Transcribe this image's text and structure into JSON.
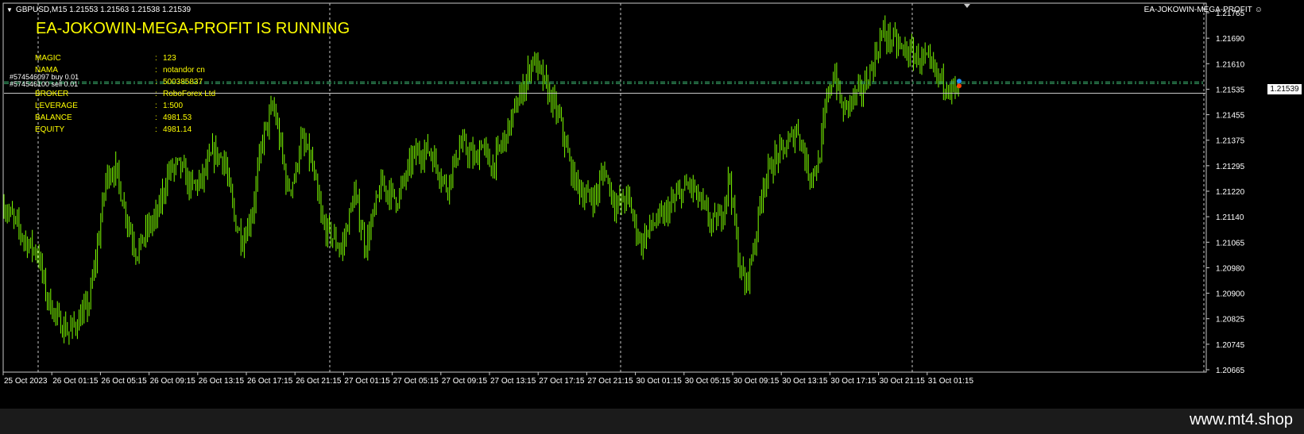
{
  "header": {
    "symbol_line": "GBPUSD,M15  1.21553 1.21563 1.21538 1.21539",
    "ea_name": "EA-JOKOWIN-MEGA-PROFIT",
    "smiley": "☺"
  },
  "ea_panel": {
    "title": "EA-JOKOWIN-MEGA-PROFIT IS RUNNING",
    "rows": [
      {
        "key": "MAGIC",
        "value": "123"
      },
      {
        "key": "NAMA",
        "value": "notandor cn"
      },
      {
        "key": "",
        "value": "500385837"
      },
      {
        "key": "BROKER",
        "value": "RoboForex Ltd"
      },
      {
        "key": "LEVERAGE",
        "value": "1:500"
      },
      {
        "key": "BALANCE",
        "value": "4981.53"
      },
      {
        "key": "EQUITY",
        "value": "4981.14"
      }
    ],
    "separator": ":"
  },
  "orders": [
    {
      "label": "#574546097 buy 0.01",
      "price": 1.21575
    },
    {
      "label": "#574546100 sell 0.01",
      "price": 1.21575
    }
  ],
  "watermark": "www.mt4.shop",
  "colors": {
    "background": "#000000",
    "candle": "#7CFC00",
    "text_yellow": "#ffff00",
    "grid": "#c8c8c8",
    "order_line": "#3cb371"
  },
  "chart_data": {
    "type": "candlestick",
    "symbol": "GBPUSD",
    "timeframe": "M15",
    "current_price": "1.21539",
    "ylim": [
      1.2066,
      1.218
    ],
    "y_ticks": [
      "1.21765",
      "1.21690",
      "1.21610",
      "1.21535",
      "1.21455",
      "1.21375",
      "1.21295",
      "1.21220",
      "1.21140",
      "1.21065",
      "1.20980",
      "1.20900",
      "1.20825",
      "1.20745",
      "1.20665"
    ],
    "x_ticks": [
      "25 Oct 2023",
      "26 Oct 01:15",
      "26 Oct 05:15",
      "26 Oct 09:15",
      "26 Oct 13:15",
      "26 Oct 17:15",
      "26 Oct 21:15",
      "27 Oct 01:15",
      "27 Oct 05:15",
      "27 Oct 09:15",
      "27 Oct 13:15",
      "27 Oct 17:15",
      "27 Oct 21:15",
      "30 Oct 01:15",
      "30 Oct 05:15",
      "30 Oct 09:15",
      "30 Oct 13:15",
      "30 Oct 17:15",
      "30 Oct 21:15",
      "31 Oct 01:15"
    ],
    "day_separators": [
      "26 Oct",
      "27 Oct",
      "30 Oct",
      "31 Oct"
    ],
    "close_path": [
      [
        0,
        1.212
      ],
      [
        16,
        1.2114
      ],
      [
        32,
        1.2107
      ],
      [
        48,
        1.2103
      ],
      [
        58,
        1.209
      ],
      [
        72,
        1.2082
      ],
      [
        86,
        1.2078
      ],
      [
        100,
        1.2082
      ],
      [
        112,
        1.2087
      ],
      [
        122,
        1.2104
      ],
      [
        134,
        1.2128
      ],
      [
        145,
        1.213
      ],
      [
        160,
        1.2114
      ],
      [
        172,
        1.2103
      ],
      [
        186,
        1.2111
      ],
      [
        198,
        1.2115
      ],
      [
        212,
        1.2129
      ],
      [
        226,
        1.2131
      ],
      [
        240,
        1.2124
      ],
      [
        254,
        1.2126
      ],
      [
        268,
        1.2135
      ],
      [
        282,
        1.2133
      ],
      [
        296,
        1.2113
      ],
      [
        306,
        1.2107
      ],
      [
        318,
        1.2117
      ],
      [
        330,
        1.2139
      ],
      [
        344,
        1.215
      ],
      [
        354,
        1.2136
      ],
      [
        362,
        1.2123
      ],
      [
        372,
        1.2128
      ],
      [
        378,
        1.2139
      ],
      [
        391,
        1.2133
      ],
      [
        406,
        1.2112
      ],
      [
        416,
        1.2109
      ],
      [
        430,
        1.2104
      ],
      [
        446,
        1.2122
      ],
      [
        460,
        1.2105
      ],
      [
        473,
        1.2118
      ],
      [
        480,
        1.2125
      ],
      [
        500,
        1.212
      ],
      [
        520,
        1.2134
      ],
      [
        540,
        1.2136
      ],
      [
        562,
        1.2124
      ],
      [
        580,
        1.2138
      ],
      [
        600,
        1.2132
      ],
      [
        605,
        1.2139
      ],
      [
        618,
        1.213
      ],
      [
        636,
        1.214
      ],
      [
        650,
        1.215
      ],
      [
        662,
        1.2158
      ],
      [
        670,
        1.2165
      ],
      [
        680,
        1.216
      ],
      [
        692,
        1.2153
      ],
      [
        705,
        1.2145
      ],
      [
        720,
        1.2128
      ],
      [
        736,
        1.2121
      ],
      [
        750,
        1.2121
      ],
      [
        760,
        1.213
      ],
      [
        775,
        1.2118
      ],
      [
        790,
        1.2121
      ],
      [
        806,
        1.2106
      ],
      [
        820,
        1.2112
      ],
      [
        836,
        1.2115
      ],
      [
        852,
        1.2121
      ],
      [
        868,
        1.2125
      ],
      [
        882,
        1.2119
      ],
      [
        896,
        1.2112
      ],
      [
        908,
        1.2115
      ],
      [
        918,
        1.2128
      ],
      [
        930,
        1.21
      ],
      [
        938,
        1.2092
      ],
      [
        950,
        1.2107
      ],
      [
        960,
        1.2125
      ],
      [
        975,
        1.2133
      ],
      [
        990,
        1.2137
      ],
      [
        1004,
        1.2143
      ],
      [
        1018,
        1.2128
      ],
      [
        1030,
        1.2131
      ],
      [
        1040,
        1.2151
      ],
      [
        1050,
        1.2161
      ],
      [
        1060,
        1.2148
      ],
      [
        1072,
        1.2152
      ],
      [
        1086,
        1.2155
      ],
      [
        1100,
        1.2164
      ],
      [
        1110,
        1.2173
      ],
      [
        1122,
        1.2171
      ],
      [
        1134,
        1.2168
      ],
      [
        1150,
        1.2166
      ],
      [
        1166,
        1.2164
      ],
      [
        1180,
        1.2159
      ],
      [
        1192,
        1.2157
      ],
      [
        1200,
        1.2155
      ],
      [
        1208,
        1.2153
      ]
    ]
  }
}
